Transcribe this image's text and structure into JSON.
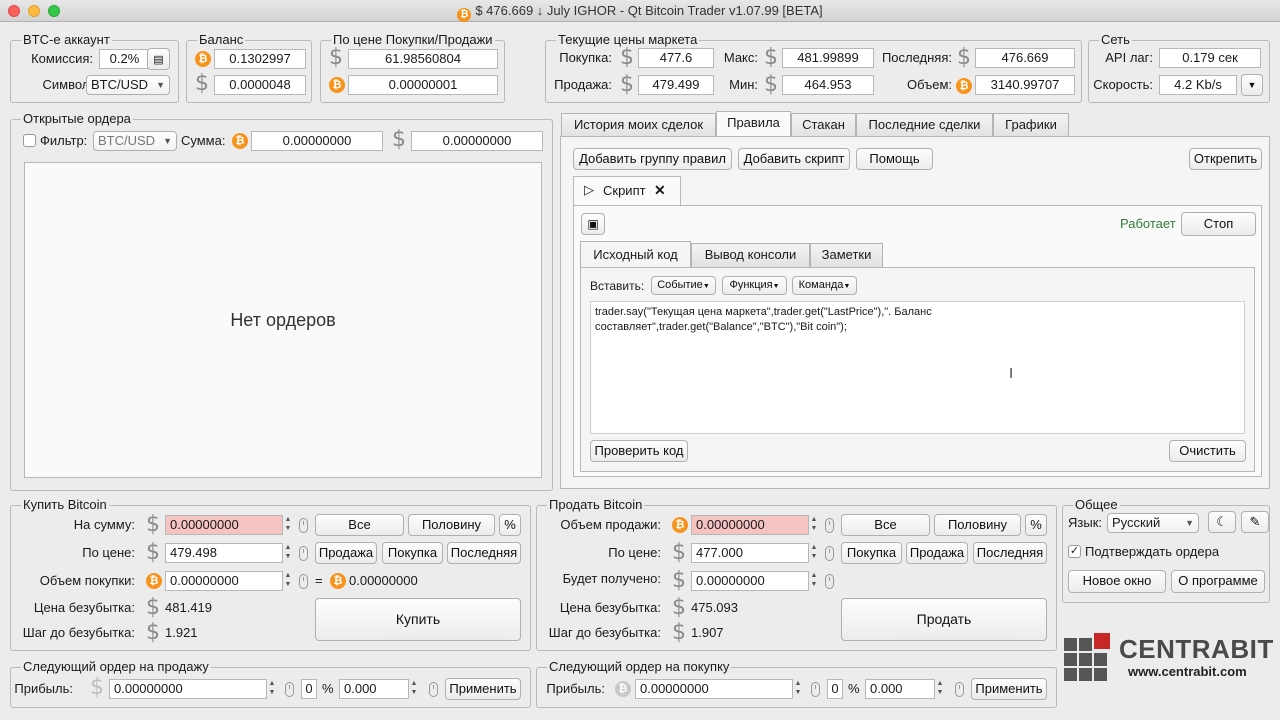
{
  "window": {
    "title": "$ 476.669 ↓ July IGHOR - Qt Bitcoin Trader v1.07.99 [BETA]"
  },
  "account": {
    "title": "BTC-е аккаунт",
    "commission_label": "Комиссия:",
    "commission": "0.2%",
    "symbol_label": "Символ:",
    "symbol": "BTC/USD"
  },
  "balance": {
    "title": "Баланс",
    "btc": "0.1302997",
    "usd": "0.0000048"
  },
  "buyprice": {
    "title": "По цене Покупки/Продажи",
    "usd": "61.98560804",
    "btc": "0.00000001"
  },
  "market": {
    "title": "Текущие цены маркета",
    "buy_label": "Покупка:",
    "buy": "477.6",
    "max_label": "Макс:",
    "max": "481.99899",
    "last_label": "Последняя:",
    "last": "476.669",
    "sell_label": "Продажа:",
    "sell": "479.499",
    "min_label": "Мин:",
    "min": "464.953",
    "volume_label": "Объем:",
    "volume": "3140.99707"
  },
  "network": {
    "title": "Сеть",
    "lag_label": "API лаг:",
    "lag": "0.179 сек",
    "speed_label": "Скорость:",
    "speed": "4.2 Kb/s"
  },
  "orders": {
    "title": "Открытые ордера",
    "filter_label": "Фильтр:",
    "filter": "BTC/USD",
    "sum_label": "Сумма:",
    "sum_btc": "0.00000000",
    "sum_usd": "0.00000000",
    "empty": "Нет ордеров"
  },
  "tabs": [
    "История моих сделок",
    "Правила",
    "Стакан",
    "Последние сделки",
    "Графики"
  ],
  "rules": {
    "add_group": "Добавить группу правил",
    "add_script": "Добавить скрипт",
    "help": "Помощь",
    "detach": "Открепить",
    "script_tab": "Скрипт",
    "status": "Работает",
    "stop": "Стоп",
    "subtabs": [
      "Исходный код",
      "Вывод консоли",
      "Заметки"
    ],
    "insert_label": "Вставить:",
    "event": "Событие",
    "function": "Функция",
    "command": "Команда",
    "code_line1": "trader.say(\"Текущая цена маркета\",trader.get(\"LastPrice\"),\". Баланс",
    "code_line2": "составляет\",trader.get(\"Balance\",\"BTC\"),\"Bit coin\");",
    "check": "Проверить код",
    "clear": "Очистить"
  },
  "buy": {
    "title": "Купить Bitcoin",
    "sum_label": "На сумму:",
    "sum": "0.00000000",
    "all": "Все",
    "half": "Половину",
    "pct": "%",
    "price_label": "По цене:",
    "price": "479.498",
    "b_sell": "Продажа",
    "b_buy": "Покупка",
    "b_last": "Последняя",
    "vol_label": "Объем покупки:",
    "vol": "0.00000000",
    "eq": "=",
    "vol_result": "0.00000000",
    "be_label": "Цена безубытка:",
    "be": "481.419",
    "step_label": "Шаг до безубытка:",
    "step": "1.921",
    "action": "Купить"
  },
  "sell": {
    "title": "Продать Bitcoin",
    "vol_label": "Объем продажи:",
    "vol": "0.00000000",
    "all": "Все",
    "half": "Половину",
    "pct": "%",
    "price_label": "По цене:",
    "price": "477.000",
    "b_buy": "Покупка",
    "b_sell": "Продажа",
    "b_last": "Последняя",
    "recv_label": "Будет получено:",
    "recv": "0.00000000",
    "be_label": "Цена безубытка:",
    "be": "475.093",
    "step_label": "Шаг до безубытка:",
    "step": "1.907",
    "action": "Продать"
  },
  "general": {
    "title": "Общее",
    "lang_label": "Язык:",
    "lang": "Русский",
    "confirm": "Подтверждать ордера",
    "new_window": "Новое окно",
    "about": "О программе"
  },
  "next_sell": {
    "title": "Следующий ордер на продажу",
    "profit_label": "Прибыль:",
    "profit": "0.00000000",
    "n": "0",
    "pct": "%",
    "pv": "0.000",
    "apply": "Применить"
  },
  "next_buy": {
    "title": "Следующий ордер на покупку",
    "profit_label": "Прибыль:",
    "profit": "0.00000000",
    "n": "0",
    "pct": "%",
    "pv": "0.000",
    "apply": "Применить"
  },
  "logo": {
    "name": "CENTRABIT",
    "url": "www.centrabit.com"
  },
  "colors": {
    "accent_green": "#2e7d32",
    "btc_orange": "#f7931a",
    "pink_field": "#f6c3c3",
    "logo_red": "#c62828"
  }
}
